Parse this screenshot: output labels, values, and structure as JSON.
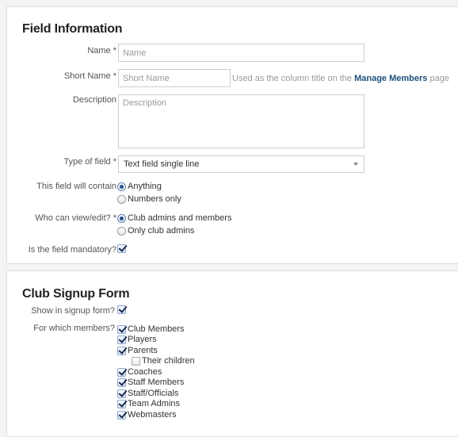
{
  "field_information": {
    "title": "Field Information",
    "name": {
      "label": "Name *",
      "value": "",
      "placeholder": "Name"
    },
    "short_name": {
      "label": "Short Name *",
      "value": "",
      "placeholder": "Short Name",
      "hint_prefix": "Used as the column title on the",
      "hint_link": "Manage Members",
      "hint_suffix": "page"
    },
    "description": {
      "label": "Description",
      "value": "",
      "placeholder": "Description"
    },
    "type_of_field": {
      "label": "Type of field *",
      "selected": "Text field single line"
    },
    "field_contains": {
      "label": "This field will contain",
      "options": [
        {
          "label": "Anything",
          "checked": true
        },
        {
          "label": "Numbers only",
          "checked": false
        }
      ]
    },
    "who_can_view": {
      "label": "Who can view/edit? *",
      "options": [
        {
          "label": "Club admins and members",
          "checked": true
        },
        {
          "label": "Only club admins",
          "checked": false
        }
      ]
    },
    "mandatory": {
      "label": "Is the field mandatory?",
      "checked": true
    }
  },
  "club_signup_form": {
    "title": "Club Signup Form",
    "show_in_signup": {
      "label": "Show in signup form?",
      "checked": true
    },
    "for_which_members": {
      "label": "For which members?",
      "options": [
        {
          "label": "Club Members",
          "checked": true
        },
        {
          "label": "Players",
          "checked": true
        },
        {
          "label": "Parents",
          "checked": true
        },
        {
          "label": "Their children",
          "checked": false
        },
        {
          "label": "Coaches",
          "checked": true
        },
        {
          "label": "Staff Members",
          "checked": true
        },
        {
          "label": "Staff/Officials",
          "checked": true
        },
        {
          "label": "Team Admins",
          "checked": true
        },
        {
          "label": "Webmasters",
          "checked": true
        }
      ]
    }
  },
  "colors": {
    "background": "#f4f4f4",
    "panel": "#ffffff",
    "link": "#1d4f7c",
    "heading": "#222222"
  }
}
